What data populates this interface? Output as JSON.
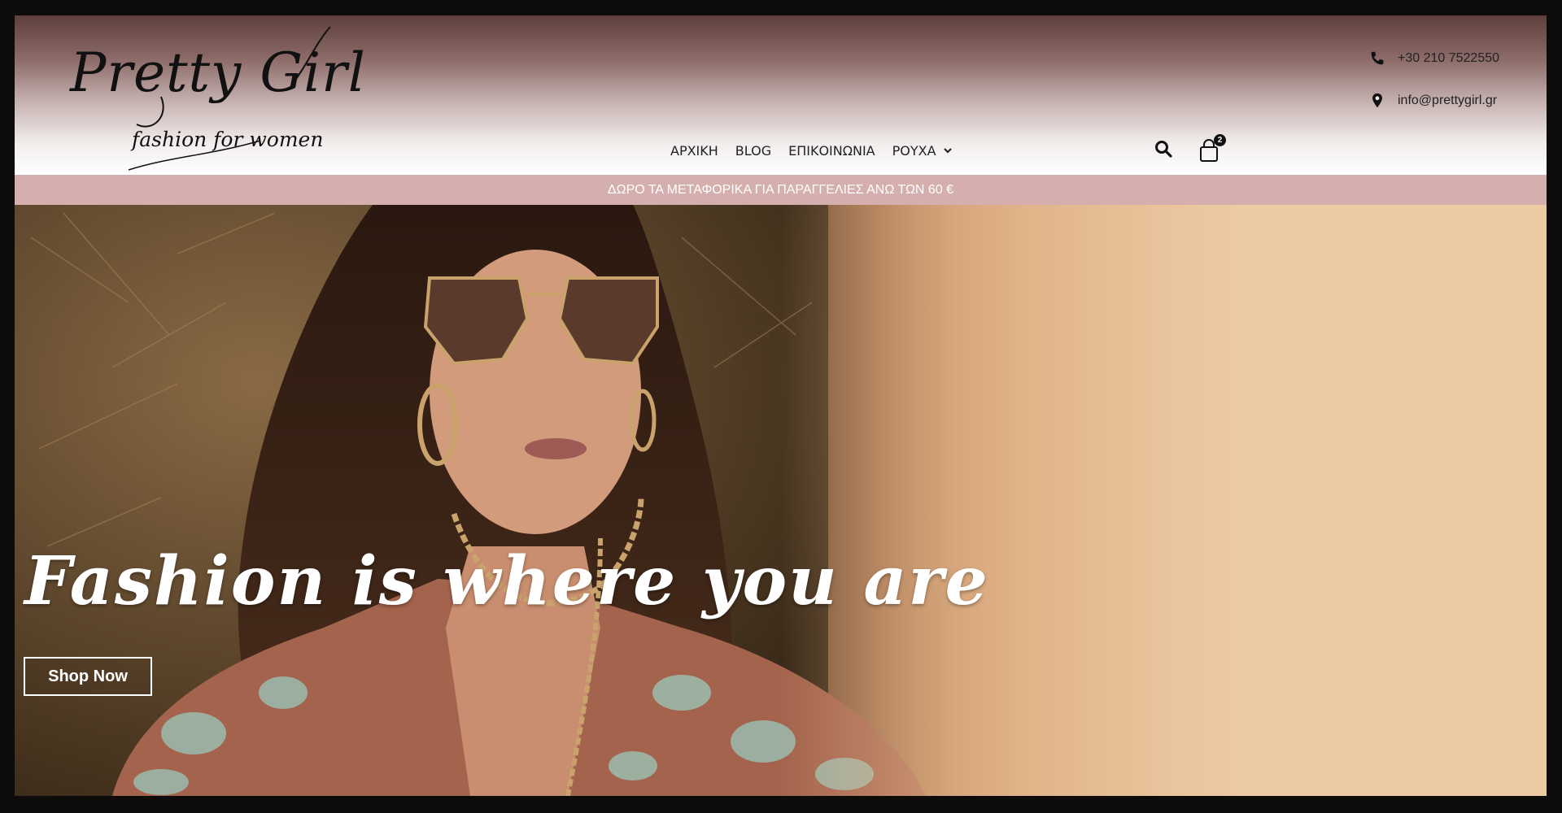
{
  "brand": {
    "title": "Pretty Girl",
    "tagline": "fashion for women"
  },
  "nav": {
    "items": [
      {
        "label": "ΑΡΧΙΚΗ"
      },
      {
        "label": "BLOG"
      },
      {
        "label": "ΕΠΙΚΟΙΝΩΝΙΑ"
      },
      {
        "label": "ΡΟΥΧΑ",
        "icon": "chevron-down-icon"
      }
    ]
  },
  "header_actions": {
    "search_icon": "search-icon",
    "cart_icon": "cart-icon",
    "cart_count": "2"
  },
  "contact": {
    "phone": "+30 210 7522550",
    "phone_icon": "phone-icon",
    "email": "info@prettygirl.gr",
    "email_icon": "map-pin-icon"
  },
  "promo": {
    "text": "ΔΩΡΟ ΤΑ ΜΕΤΑΦΟΡΙΚΑ ΓΙΑ ΠΑΡΑΓΓΕΛΙΕΣ ΑΝΩ ΤΩΝ 60 €"
  },
  "hero": {
    "headline": "Fashion is where you are",
    "cta_label": "Shop Now"
  },
  "colors": {
    "promo_bar": "#d5afae",
    "frame": "#0e0b0b",
    "text_dark": "#222222"
  }
}
